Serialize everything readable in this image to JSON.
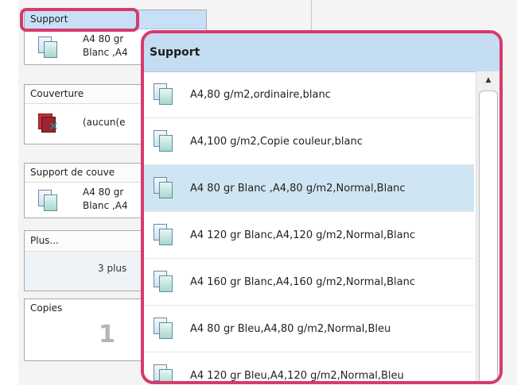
{
  "left_panel": {
    "support": {
      "header": "Support",
      "line1": "A4 80 gr",
      "line2": "Blanc ,A4"
    },
    "couverture": {
      "header": "Couverture",
      "value": "(aucun(e"
    },
    "support_couverture": {
      "header": "Support de couve",
      "line1": "A4 80 gr",
      "line2": "Blanc ,A4"
    },
    "plus": {
      "header": "Plus...",
      "value": "3 plus"
    },
    "copies": {
      "header": "Copies",
      "value": "1"
    }
  },
  "popup": {
    "title": "Support",
    "items": [
      {
        "label": "A4,80 g/m2,ordinaire,blanc",
        "selected": false
      },
      {
        "label": "A4,100 g/m2,Copie couleur,blanc",
        "selected": false
      },
      {
        "label": "A4 80 gr Blanc ,A4,80 g/m2,Normal,Blanc",
        "selected": true
      },
      {
        "label": "A4 120 gr Blanc,A4,120 g/m2,Normal,Blanc",
        "selected": false
      },
      {
        "label": "A4 160 gr Blanc,A4,160 g/m2,Normal,Blanc",
        "selected": false
      },
      {
        "label": "A4 80 gr Bleu,A4,80 g/m2,Normal,Bleu",
        "selected": false
      },
      {
        "label": "A4 120 gr Bleu,A4,120 g/m2,Normal,Bleu",
        "selected": false
      }
    ],
    "scroll_up_glyph": "▲"
  },
  "colors": {
    "highlight": "#d63b6a",
    "header_blue": "#c5ddf2",
    "selected_row": "#d0e5f3"
  },
  "icons": {
    "paper": "paper-stack-icon",
    "cover": "cover-none-icon"
  }
}
